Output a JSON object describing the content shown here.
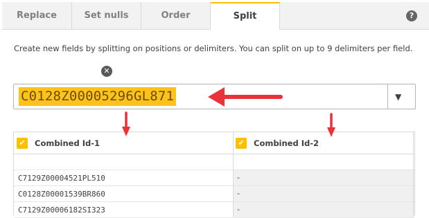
{
  "tabs": [
    {
      "label": "Replace",
      "active": false
    },
    {
      "label": "Set nulls",
      "active": false
    },
    {
      "label": "Order",
      "active": false
    },
    {
      "label": "Split",
      "active": true
    }
  ],
  "help_icon": "?",
  "description": "Create new fields by splitting on positions or delimiters. You can split on up to 9 delimiters per field.",
  "clear_icon": "✕",
  "combo": {
    "value": "C0128Z00005296GL871",
    "caret_icon": "▼"
  },
  "table": {
    "columns": [
      {
        "label": "Combined Id-1",
        "checked": true
      },
      {
        "label": "Combined Id-2",
        "checked": true
      }
    ],
    "check_icon": "✔",
    "rows": [
      {
        "col1": "",
        "col2": ""
      },
      {
        "col1": "C7129Z00004521PL510",
        "col2": "-"
      },
      {
        "col1": "C0128Z00001539BR860",
        "col2": "-"
      },
      {
        "col1": "C7129Z00006182SI323",
        "col2": "-"
      }
    ]
  },
  "colors": {
    "accent": "#ffc000",
    "highlight": "#ffc21a",
    "annotation_arrow": "#e8333a"
  },
  "annotations": {
    "arrow_icons": [
      "left-arrow",
      "down-arrow",
      "down-arrow"
    ]
  }
}
